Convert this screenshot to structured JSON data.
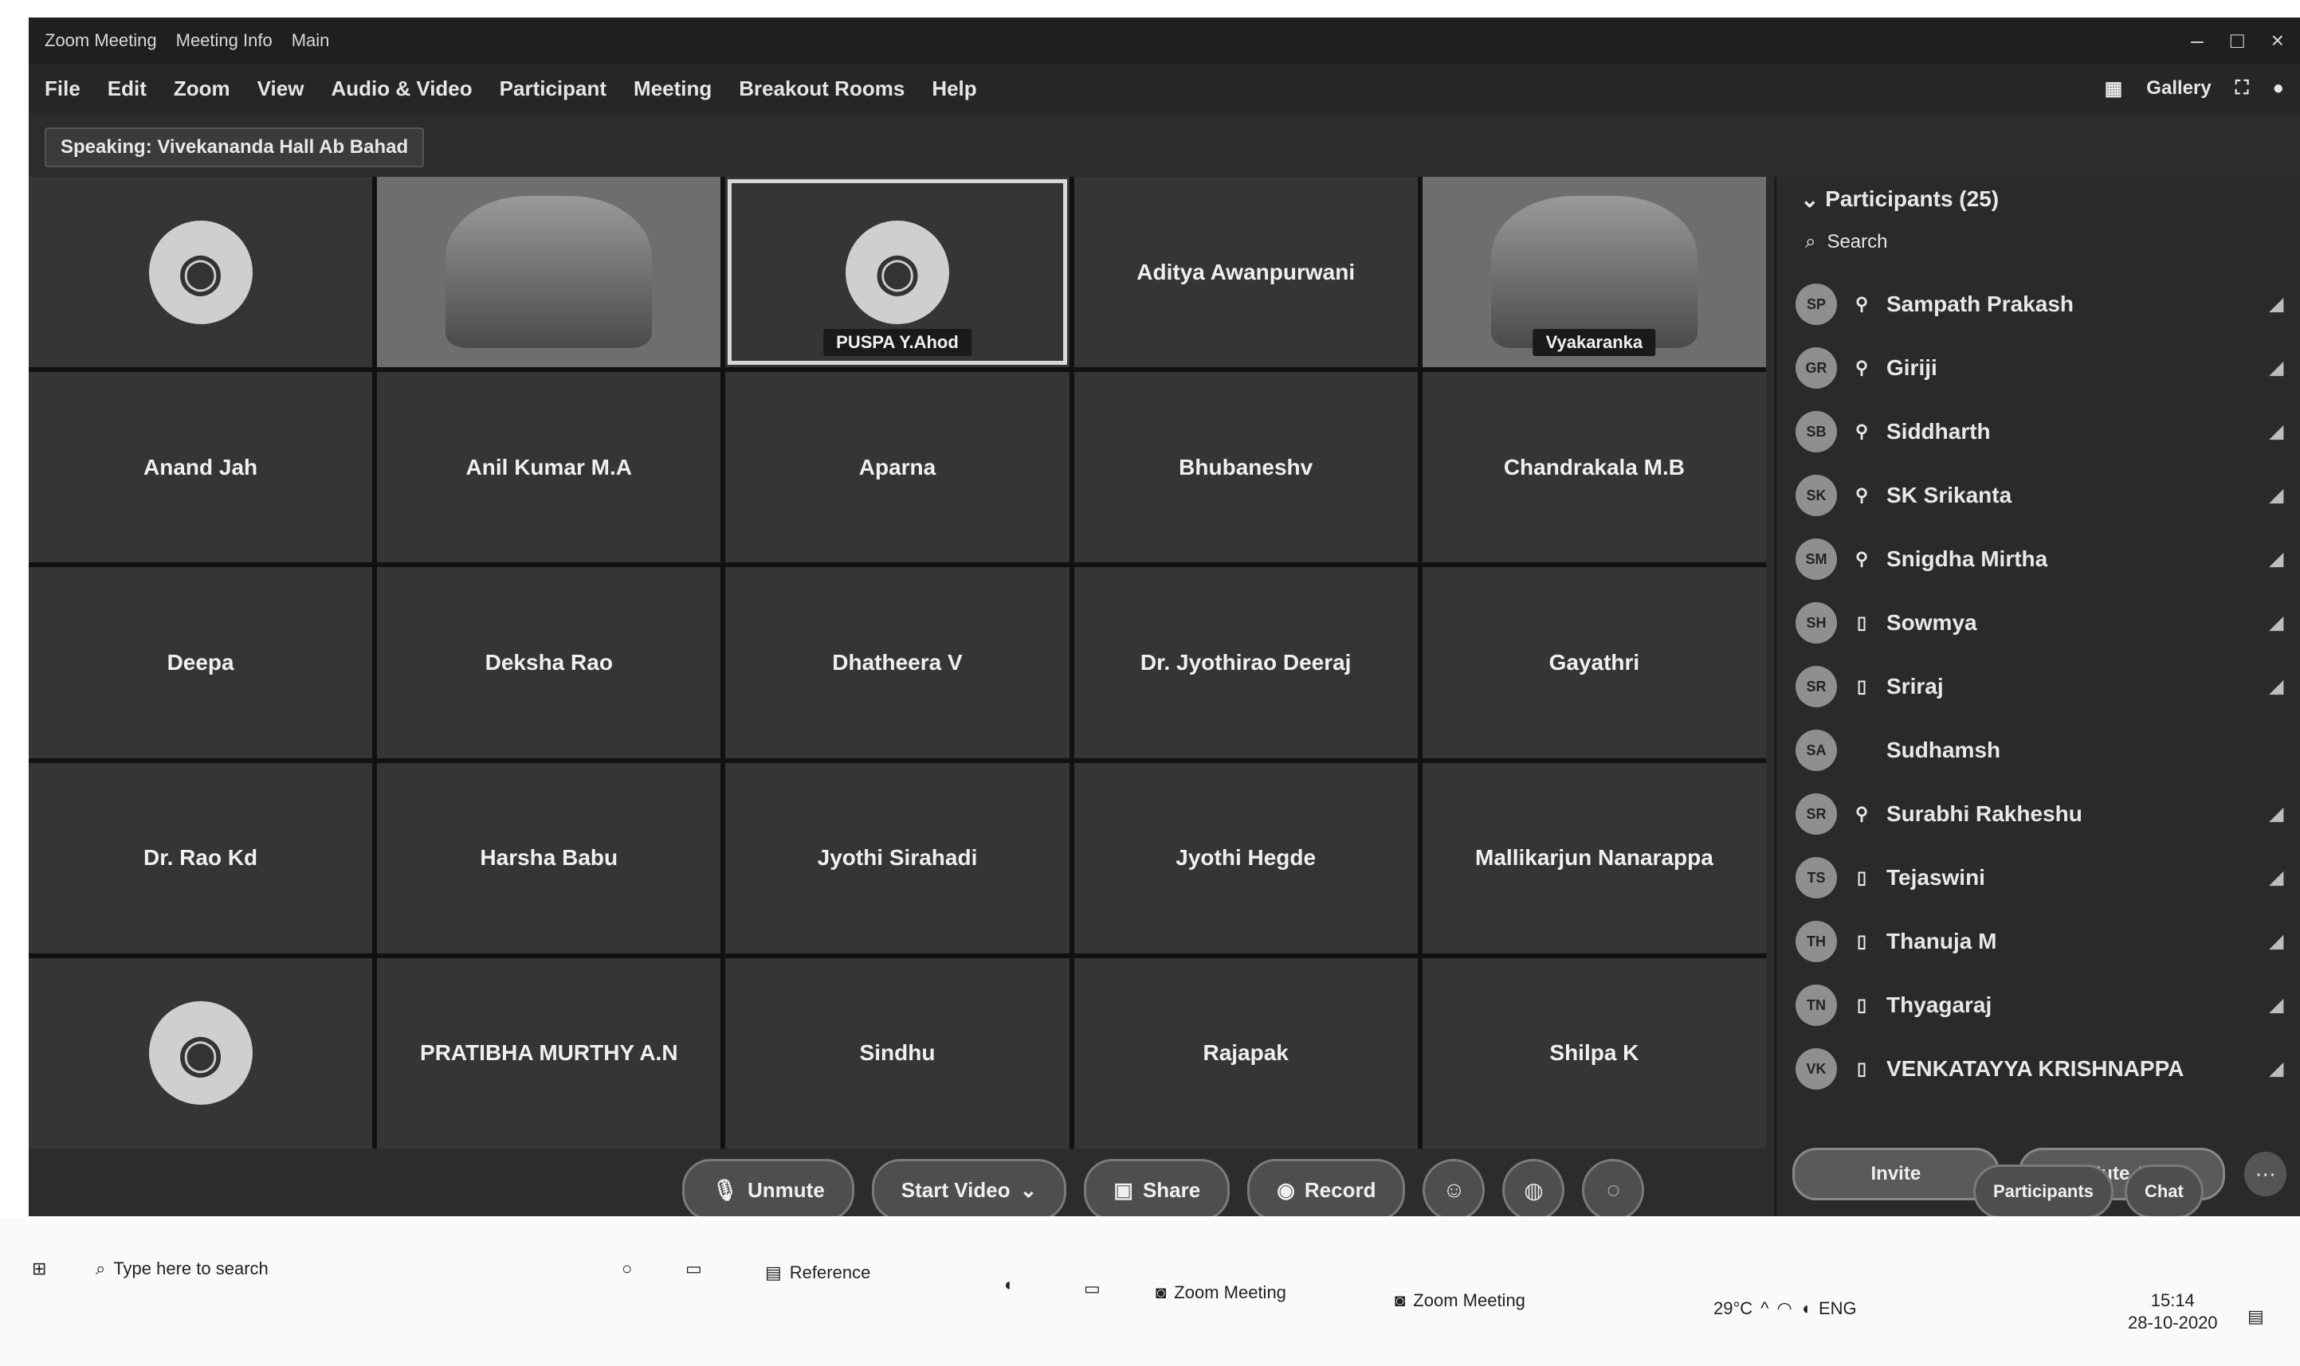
{
  "window": {
    "title": "Zoom Meeting",
    "tabs": [
      "Meeting Info",
      "Main"
    ]
  },
  "menu": {
    "items": [
      "File",
      "Edit",
      "Zoom",
      "View",
      "Audio & Video",
      "Participant",
      "Meeting",
      "Breakout Rooms",
      "Help"
    ],
    "right_label": "Gallery"
  },
  "speaking": "Speaking: Vivekananda Hall Ab Bahad",
  "tiles": [
    {
      "kind": "avatar",
      "name": ""
    },
    {
      "kind": "video",
      "name": ""
    },
    {
      "kind": "avatar",
      "name": "PUSPA Y.Ahod",
      "highlight": true
    },
    {
      "kind": "name",
      "name": "Aditya Awanpurwani"
    },
    {
      "kind": "video",
      "name": "Vyakaranka"
    },
    {
      "kind": "name",
      "name": "Anand Jah"
    },
    {
      "kind": "name",
      "name": "Anil Kumar M.A"
    },
    {
      "kind": "name",
      "name": "Aparna"
    },
    {
      "kind": "name",
      "name": "Bhubaneshv"
    },
    {
      "kind": "name",
      "name": "Chandrakala M.B"
    },
    {
      "kind": "name",
      "name": "Deepa"
    },
    {
      "kind": "name",
      "name": "Deksha Rao"
    },
    {
      "kind": "name",
      "name": "Dhatheera V"
    },
    {
      "kind": "name",
      "name": "Dr. Jyothirao Deeraj"
    },
    {
      "kind": "name",
      "name": "Gayathri"
    },
    {
      "kind": "name",
      "name": "Dr. Rao Kd"
    },
    {
      "kind": "name",
      "name": "Harsha Babu"
    },
    {
      "kind": "name",
      "name": "Jyothi Sirahadi"
    },
    {
      "kind": "name",
      "name": "Jyothi Hegde"
    },
    {
      "kind": "name",
      "name": "Mallikarjun Nanarappa"
    },
    {
      "kind": "avatar",
      "name": ""
    },
    {
      "kind": "name",
      "name": "PRATIBHA MURTHY A.N"
    },
    {
      "kind": "name",
      "name": "Sindhu"
    },
    {
      "kind": "name",
      "name": "Rajapak"
    },
    {
      "kind": "name",
      "name": "Shilpa K"
    }
  ],
  "panel": {
    "title": "Participants (25)",
    "search_placeholder": "Search",
    "participants": [
      {
        "initials": "SP",
        "name": "Sampath Prakash"
      },
      {
        "initials": "GR",
        "name": "Giriji"
      },
      {
        "initials": "SB",
        "name": "Siddharth"
      },
      {
        "initials": "SK",
        "name": "SK Srikanta"
      },
      {
        "initials": "SM",
        "name": "Snigdha Mirtha"
      },
      {
        "initials": "SH",
        "name": "Sowmya"
      },
      {
        "initials": "SR",
        "name": "Sriraj"
      },
      {
        "initials": "SA",
        "name": "Sudhamsh"
      },
      {
        "initials": "SR",
        "name": "Surabhi Rakheshu"
      },
      {
        "initials": "TS",
        "name": "Tejaswini"
      },
      {
        "initials": "TH",
        "name": "Thanuja M"
      },
      {
        "initials": "TN",
        "name": "Thyagaraj"
      },
      {
        "initials": "VK",
        "name": "VENKATAYYA KRISHNAPPA"
      }
    ],
    "invite_label": "Invite",
    "mute_all_label": "Mute All"
  },
  "controls": {
    "unmute_label": "Unmute",
    "start_video_label": "Start Video",
    "share_label": "Share",
    "record_label": "Record"
  },
  "end": {
    "participants_label": "Participants",
    "chat_label": "Chat"
  },
  "taskbar": {
    "search_placeholder": "Type here to search",
    "app1": "Reference",
    "app2": "Zoom Meeting",
    "app3": "Zoom Meeting",
    "temp": "29°C",
    "lang": "ENG",
    "time": "15:14",
    "date": "28-10-2020"
  }
}
